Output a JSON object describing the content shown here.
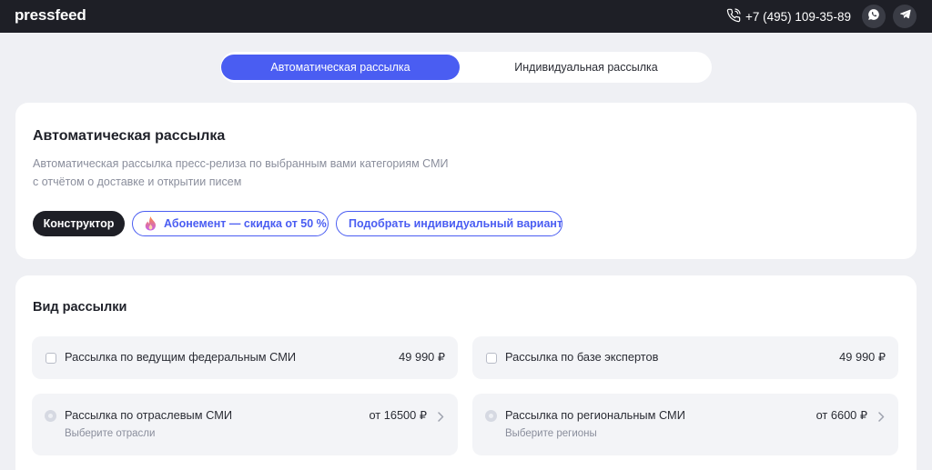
{
  "header": {
    "logo": "pressfeed",
    "phone": "+7 (495) 109-35-89",
    "icons": [
      "phone-icon",
      "whatsapp-icon",
      "telegram-icon"
    ]
  },
  "toggle": {
    "active_label": "Автоматическая рассылка",
    "inactive_label": "Индивидуальная рассылка"
  },
  "intro": {
    "title": "Автоматическая рассылка",
    "description_line1": "Автоматическая рассылка пресс-релиза по выбранным вами категориям СМИ",
    "description_line2": "с отчётом о доставке и открытии писем",
    "pills": {
      "constructor": "Конструктор",
      "subscription": "Абонемент — скидка от 50 %",
      "individual": "Подобрать индивидуальный вариант"
    }
  },
  "mailing": {
    "title": "Вид рассылки",
    "options": [
      {
        "label": "Рассылка по ведущим федеральным СМИ",
        "price": "49 990 ₽"
      },
      {
        "label": "Рассылка по базе экспертов",
        "price": "49 990 ₽"
      },
      {
        "label": "Рассылка по отраслевым СМИ",
        "price": "от 16500 ₽",
        "sub": "Выберите отрасли"
      },
      {
        "label": "Рассылка по региональным СМИ",
        "price": "от 6600 ₽",
        "sub": "Выберите регионы"
      }
    ]
  },
  "colors": {
    "accent": "#4a5df2",
    "dark": "#1e1f26",
    "background": "#eff0f4"
  }
}
